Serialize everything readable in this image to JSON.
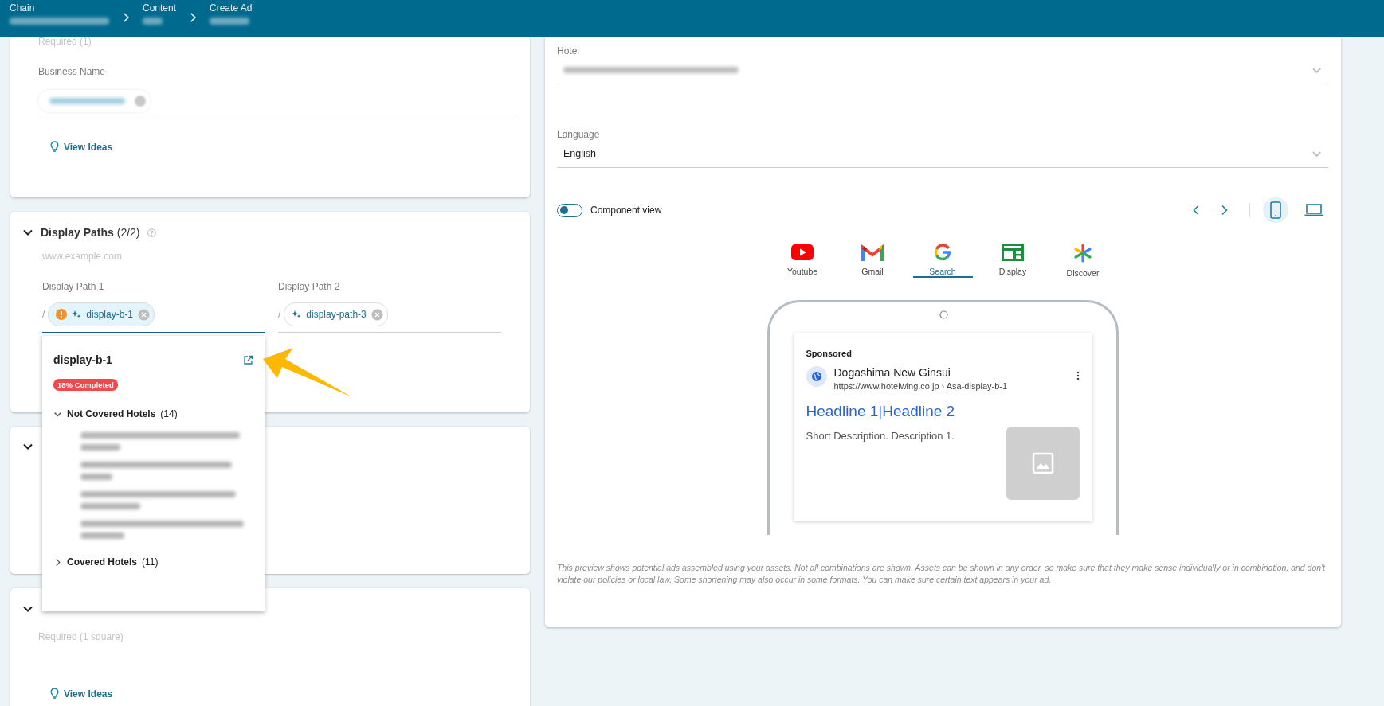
{
  "breadcrumbs": [
    {
      "label": "Chain"
    },
    {
      "label": "Content"
    },
    {
      "label": "Create Ad"
    }
  ],
  "business_card": {
    "required_note": "Required (1)",
    "field_label": "Business Name",
    "link": "View Ideas"
  },
  "display_paths": {
    "title": "Display Paths",
    "count": "(2/2)",
    "domain": "www.example.com",
    "paths": [
      {
        "label": "Display Path 1",
        "separator": "/",
        "chip": "display-b-1",
        "warning": true,
        "focused": true
      },
      {
        "label": "Display Path 2",
        "separator": "/",
        "chip": "display-path-3",
        "warning": false,
        "focused": false
      }
    ]
  },
  "popover": {
    "title": "display-b-1",
    "badge": "18% Completed",
    "groups": [
      {
        "label": "Not Covered Hotels",
        "count": "(14)",
        "expanded": true
      },
      {
        "label": "Covered Hotels",
        "count": "(11)",
        "expanded": false
      }
    ]
  },
  "logos_card": {
    "required_note": "Required (1 square)",
    "link": "View Ideas"
  },
  "preview": {
    "hotel_label": "Hotel",
    "language_label": "Language",
    "language_value": "English",
    "component_view": {
      "label": "Component view",
      "on": false
    },
    "devices": [
      {
        "kind": "phone",
        "selected": true
      },
      {
        "kind": "laptop",
        "selected": false
      }
    ],
    "channels": [
      {
        "kind": "youtube",
        "label": "Youtube",
        "selected": false
      },
      {
        "kind": "gmail",
        "label": "Gmail",
        "selected": false
      },
      {
        "kind": "search",
        "label": "Search",
        "selected": true
      },
      {
        "kind": "display",
        "label": "Display",
        "selected": false
      },
      {
        "kind": "discover",
        "label": "Discover",
        "selected": false
      }
    ],
    "ad": {
      "sponsored": "Sponsored",
      "business": "Dogashima New Ginsui",
      "url": "https://www.hotelwing.co.jp › Asa-display-b-1",
      "headline": "Headline 1|Headline 2",
      "description": "Short Description. Description 1."
    },
    "disclaimer": "This preview shows potential ads assembled using your assets. Not all combinations are shown. Assets can be shown in any order, so make sure that they make sense individually or in combination, and don't violate our policies or local law. Some shortening may also occur in some formats. You can make sure certain text appears in your ad."
  }
}
